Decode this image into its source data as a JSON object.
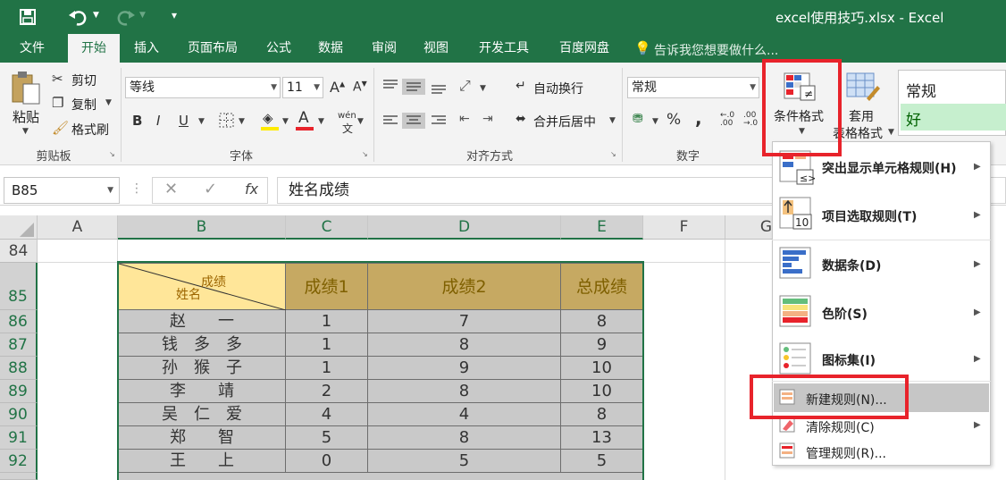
{
  "qat": {
    "save_icon": "save-icon",
    "undo_icon": "undo-icon",
    "redo_icon": "redo-icon"
  },
  "title": "excel使用技巧.xlsx - Excel",
  "tabs": [
    "文件",
    "开始",
    "插入",
    "页面布局",
    "公式",
    "数据",
    "审阅",
    "视图",
    "开发工具",
    "百度网盘"
  ],
  "tellme": "告诉我您想要做什么...",
  "clipboard": {
    "paste": "粘贴",
    "cut": "剪切",
    "copy": "复制",
    "painter": "格式刷",
    "group": "剪贴板"
  },
  "font": {
    "name": "等线",
    "size": "11",
    "bold": "B",
    "italic": "I",
    "underline": "U",
    "wen": "wén",
    "group": "字体"
  },
  "align": {
    "wrap": "自动换行",
    "merge": "合并后居中",
    "group": "对齐方式"
  },
  "number": {
    "format": "常规",
    "percent": "%",
    "comma": ",",
    "group": "数字"
  },
  "styles": {
    "cond": "条件格式",
    "table1": "套用",
    "table2": "表格格式",
    "normal": "常规",
    "good": "好"
  },
  "namebox": "B85",
  "formula": "姓名成绩",
  "fx": "fx",
  "columns": [
    "A",
    "B",
    "C",
    "D",
    "E",
    "F",
    "G"
  ],
  "header": {
    "diag_top": "成绩",
    "diag_bottom": "姓名",
    "c": "成绩1",
    "d": "成绩2",
    "e": "总成绩"
  },
  "rows": [
    {
      "n": "84"
    },
    {
      "n": "85"
    },
    {
      "n": "86",
      "name": "赵　　一",
      "c": "1",
      "d": "7",
      "e": "8"
    },
    {
      "n": "87",
      "name": "钱　多　多",
      "c": "1",
      "d": "8",
      "e": "9"
    },
    {
      "n": "88",
      "name": "孙　猴　子",
      "c": "1",
      "d": "9",
      "e": "10"
    },
    {
      "n": "89",
      "name": "李　　靖",
      "c": "2",
      "d": "8",
      "e": "10"
    },
    {
      "n": "90",
      "name": "吴　仁　爱",
      "c": "4",
      "d": "4",
      "e": "8"
    },
    {
      "n": "91",
      "name": "郑　　智",
      "c": "5",
      "d": "8",
      "e": "13"
    },
    {
      "n": "92",
      "name": "王　　上",
      "c": "0",
      "d": "5",
      "e": "5"
    }
  ],
  "menu": {
    "highlight": "突出显示单元格规则(H)",
    "topbottom": "项目选取规则(T)",
    "databar": "数据条(D)",
    "colorscale": "色阶(S)",
    "iconset": "图标集(I)",
    "newrule": "新建规则(N)...",
    "clear": "清除规则(C)",
    "manage": "管理规则(R)..."
  },
  "colors": {
    "excel_green": "#217346",
    "header_fill": "#c6a962",
    "diag_fill": "#ffe699",
    "data_fill": "#c9c9c9",
    "highlight_red": "#e8232b"
  }
}
